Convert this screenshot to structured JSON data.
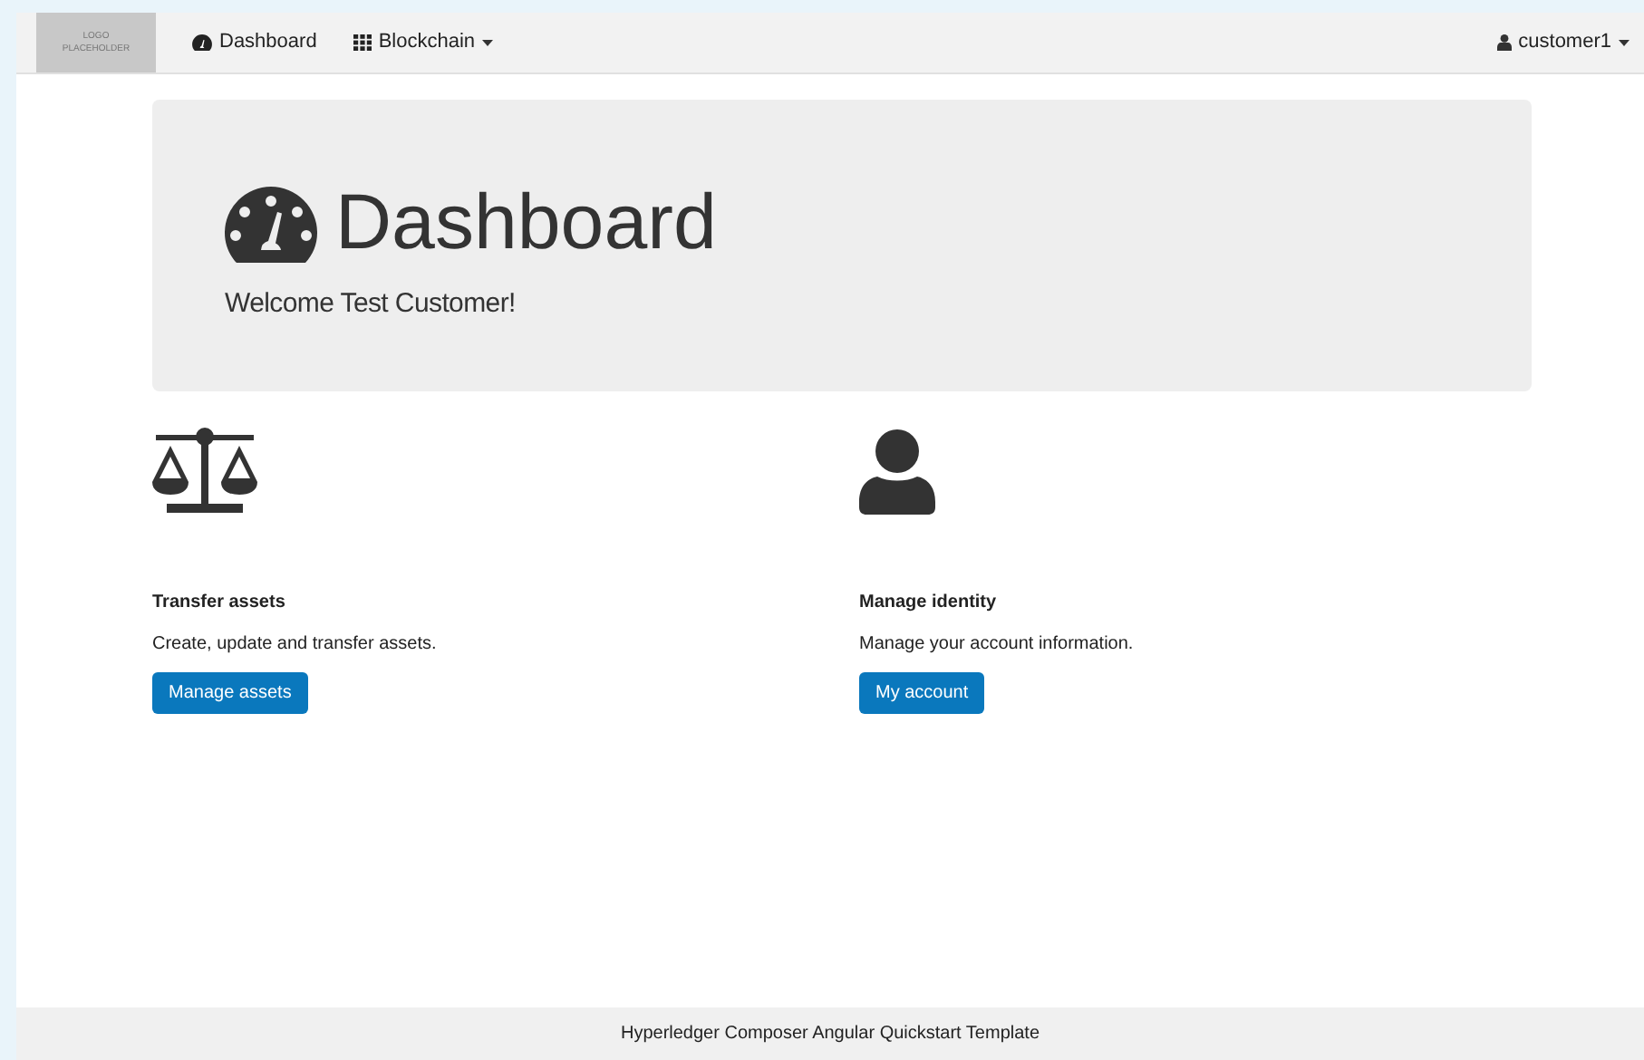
{
  "navbar": {
    "logo": "LOGO PLACEHOLDER",
    "items": [
      {
        "label": "Dashboard",
        "kind": "dashboard",
        "dropdown": false
      },
      {
        "label": "Blockchain",
        "kind": "grid",
        "dropdown": true
      }
    ],
    "user": {
      "label": "customer1",
      "dropdown": true
    }
  },
  "jumbotron": {
    "title": "Dashboard",
    "subtitle": "Welcome Test Customer!"
  },
  "cards": [
    {
      "kind": "scale",
      "title": "Transfer assets",
      "description": "Create, update and transfer assets.",
      "button": "Manage assets"
    },
    {
      "kind": "user",
      "title": "Manage identity",
      "description": "Manage your account information.",
      "button": "My account"
    }
  ],
  "footer": "Hyperledger Composer Angular Quickstart Template"
}
